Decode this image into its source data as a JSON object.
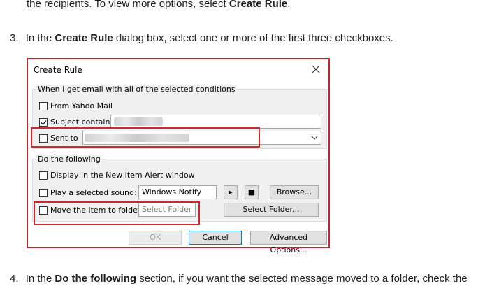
{
  "doc": {
    "line1_prefix": "the recipients. To view more options, select ",
    "line1_bold": "Create Rule",
    "line1_suffix": ".",
    "step3_number": "3.",
    "step3_prefix": "In the ",
    "step3_bold": "Create Rule",
    "step3_suffix": " dialog box, select one or more of the first three checkboxes.",
    "step4_number": "4.",
    "step4_prefix": "In the ",
    "step4_bold": "Do the following",
    "step4_suffix": " section, if you want the selected message moved to a folder, check the "
  },
  "dialog": {
    "title": "Create Rule",
    "conditions_group": "When I get email with all of the selected conditions",
    "from_label": "From Yahoo Mail",
    "subject_label": "Subject contains",
    "subject_checked": true,
    "sent_to_label": "Sent to",
    "sent_to_checked": false,
    "do_following_group": "Do the following",
    "display_alert_label": "Display in the New Item Alert window",
    "play_sound_label": "Play a selected sound:",
    "sound_value": "Windows Notify Email.",
    "browse_label": "Browse...",
    "move_label": "Move the item to folder:",
    "select_folder_placeholder": "Select Folder",
    "select_folder_button": "Select Folder...",
    "ok_label": "OK",
    "cancel_label": "Cancel",
    "advanced_label": "Advanced Options..."
  },
  "colors": {
    "highlight": "#d0262d",
    "primary_border": "#0078d7"
  }
}
